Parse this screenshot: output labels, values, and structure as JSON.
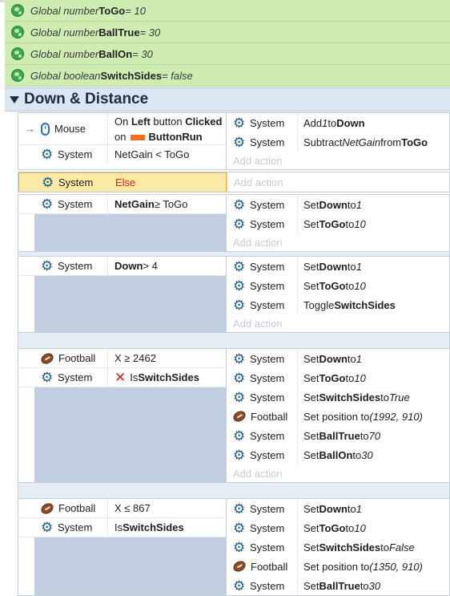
{
  "globals": [
    {
      "prefix": "Global number ",
      "name": "ToGo",
      "suffix": " = 10"
    },
    {
      "prefix": "Global number ",
      "name": "BallTrue",
      "suffix": " = 30"
    },
    {
      "prefix": "Global number ",
      "name": "BallOn",
      "suffix": " = 30"
    },
    {
      "prefix": "Global boolean ",
      "name": "SwitchSides",
      "suffix": " = false"
    }
  ],
  "group": {
    "title": "Down & Distance"
  },
  "add_action": "Add action",
  "objects": {
    "system": "System",
    "mouse": "Mouse",
    "football": "Football"
  },
  "events": {
    "e1": {
      "cond1": {
        "pre": "On ",
        "b1": "Left",
        "mid": " button ",
        "b2": "Clicked",
        "line2pre": "on",
        "b3": "ButtonRun"
      },
      "cond2": "NetGain < ToGo",
      "act1": {
        "pre": "Add ",
        "i": "1",
        "mid": " to ",
        "b": "Down"
      },
      "act2": {
        "pre": "Subtract ",
        "i": "NetGain",
        "mid": " from ",
        "b": "ToGo"
      }
    },
    "e2": {
      "cond": "Else"
    },
    "e3": {
      "cond_b": "NetGain",
      "cond_rest": " ≥ ToGo",
      "act1": {
        "pre": "Set ",
        "b": "Down",
        "mid": " to ",
        "i": "1"
      },
      "act2": {
        "pre": "Set ",
        "b": "ToGo",
        "mid": " to ",
        "i": "10"
      }
    },
    "e4": {
      "cond_b": "Down",
      "cond_rest": " > 4",
      "act1": {
        "pre": "Set ",
        "b": "Down",
        "mid": " to ",
        "i": "1"
      },
      "act2": {
        "pre": "Set ",
        "b": "ToGo",
        "mid": " to ",
        "i": "10"
      },
      "act3": {
        "pre": "Toggle ",
        "b": "SwitchSides"
      }
    },
    "e5": {
      "cond1": "X ≥ 2462",
      "cond2_pre": "Is ",
      "cond2_b": "SwitchSides",
      "act1": {
        "pre": "Set ",
        "b": "Down",
        "mid": " to ",
        "i": "1"
      },
      "act2": {
        "pre": "Set ",
        "b": "ToGo",
        "mid": " to ",
        "i": "10"
      },
      "act3": {
        "pre": "Set ",
        "b": "SwitchSides",
        "mid": " to ",
        "i": "True"
      },
      "act4": {
        "pre": "Set position to ",
        "i": "(1992, 910)"
      },
      "act5": {
        "pre": "Set ",
        "b": "BallTrue",
        "mid": " to ",
        "i": "70"
      },
      "act6": {
        "pre": "Set ",
        "b": "BallOn",
        "mid": " to ",
        "i": "30"
      }
    },
    "e6": {
      "cond1": "X ≤ 867",
      "cond2_pre": "Is ",
      "cond2_b": "SwitchSides",
      "act1": {
        "pre": "Set ",
        "b": "Down",
        "mid": " to ",
        "i": "1"
      },
      "act2": {
        "pre": "Set ",
        "b": "ToGo",
        "mid": " to ",
        "i": "10"
      },
      "act3": {
        "pre": "Set ",
        "b": "SwitchSides",
        "mid": " to ",
        "i": "False"
      },
      "act4": {
        "pre": "Set position to ",
        "i": "(1350, 910)"
      },
      "act5": {
        "pre": "Set ",
        "b": "BallTrue",
        "mid": " to ",
        "i": "30"
      }
    }
  },
  "colors": {
    "global_bg": "#cfecb2",
    "group_bg": "#dce6f3",
    "selected_bg": "#fbeaa6",
    "system_icon": "#1d5f88"
  }
}
